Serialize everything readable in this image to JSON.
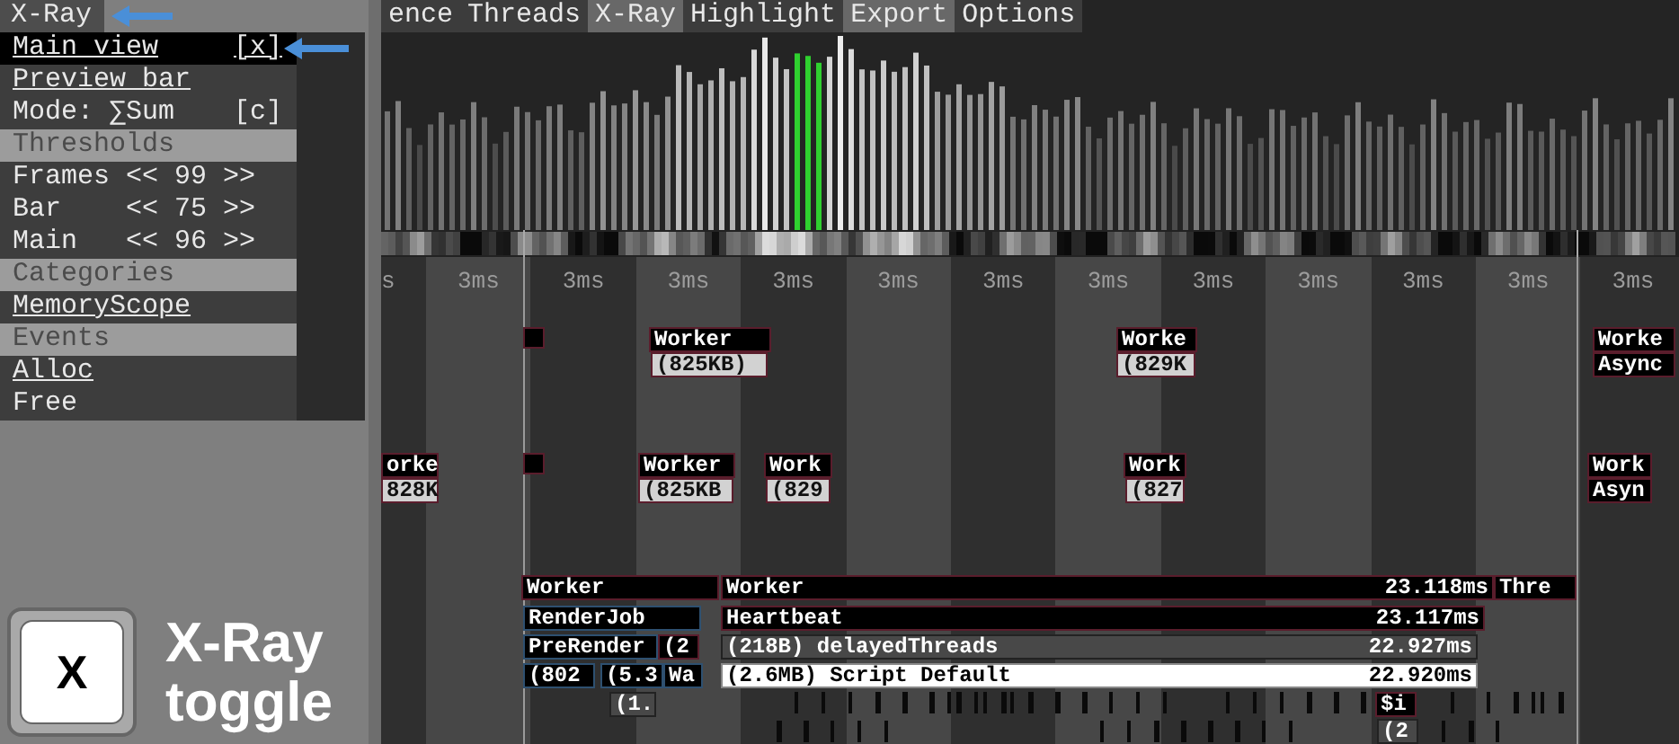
{
  "xray_menu": {
    "title": "X-Ray",
    "items": [
      {
        "kind": "toggle",
        "label": "Main view",
        "shortcut": "[x]",
        "on": true,
        "selected": true
      },
      {
        "kind": "toggle",
        "label": "Preview bar",
        "on": true,
        "selected": false
      },
      {
        "kind": "option",
        "label": "Mode: ∑Sum",
        "shortcut": "[c]",
        "selected": false
      },
      {
        "kind": "header",
        "label": "Thresholds"
      },
      {
        "kind": "stepper",
        "label": "Frames",
        "decrease": "<<",
        "value": "99",
        "increase": ">>",
        "selected": false
      },
      {
        "kind": "stepper",
        "label": "Bar",
        "decrease": "<<",
        "value": "75",
        "increase": ">>",
        "selected": false
      },
      {
        "kind": "stepper",
        "label": "Main",
        "decrease": "<<",
        "value": "96",
        "increase": ">>",
        "selected": false
      },
      {
        "kind": "header",
        "label": "Categories"
      },
      {
        "kind": "toggle",
        "label": "MemoryScope",
        "on": true,
        "selected": false
      },
      {
        "kind": "header",
        "label": "Events"
      },
      {
        "kind": "toggle",
        "label": "Alloc",
        "on": true,
        "selected": false
      },
      {
        "kind": "toggle",
        "label": "Free",
        "on": false,
        "selected": false
      }
    ]
  },
  "tabs": [
    {
      "label": "ence",
      "highlighted": false
    },
    {
      "label": "Threads",
      "highlighted": false
    },
    {
      "label": "X-Ray",
      "highlighted": true
    },
    {
      "label": "Highlight",
      "highlighted": false
    },
    {
      "label": "Export",
      "highlighted": true
    },
    {
      "label": "Options",
      "highlighted": false
    }
  ],
  "timeline": {
    "time_labels": [
      "s",
      "3ms",
      "3ms",
      "3ms",
      "3ms",
      "3ms",
      "3ms",
      "3ms",
      "3ms",
      "3ms",
      "3ms",
      "3ms",
      "3ms"
    ],
    "events": [
      {
        "kind": "marker"
      },
      {
        "kind": "thread",
        "label": "Worker"
      },
      {
        "kind": "thread",
        "label": "Worke"
      },
      {
        "kind": "thread",
        "label": "Worke"
      },
      {
        "kind": "size",
        "label": "(825KB)"
      },
      {
        "kind": "size",
        "label": "(829K"
      },
      {
        "kind": "thread",
        "label": "Async"
      },
      {
        "kind": "thread",
        "label": "orke"
      },
      {
        "kind": "marker"
      },
      {
        "kind": "thread",
        "label": "Worker"
      },
      {
        "kind": "thread",
        "label": "Work"
      },
      {
        "kind": "thread",
        "label": "Work"
      },
      {
        "kind": "thread",
        "label": "Work"
      },
      {
        "kind": "size",
        "label": "828K"
      },
      {
        "kind": "size",
        "label": "(825KB"
      },
      {
        "kind": "size",
        "label": "(829"
      },
      {
        "kind": "size",
        "label": "(827"
      },
      {
        "kind": "thread",
        "label": "Asyn"
      }
    ],
    "call_stack": [
      {
        "kind": "thread",
        "label": "Worker"
      },
      {
        "kind": "thread",
        "label": "Worker",
        "duration": "23.118ms"
      },
      {
        "kind": "thread",
        "label": "Thre"
      },
      {
        "kind": "scope",
        "label": "RenderJob"
      },
      {
        "kind": "thread",
        "label": "Heartbeat",
        "duration": "23.117ms"
      },
      {
        "kind": "scope",
        "label": "PreRender"
      },
      {
        "kind": "thread",
        "label": "(2"
      },
      {
        "kind": "memory",
        "label": "(218B) delayedThreads",
        "duration": "22.927ms"
      },
      {
        "kind": "scope",
        "label": "(802"
      },
      {
        "kind": "scope",
        "label": "(5.3"
      },
      {
        "kind": "scope",
        "label": "Wa"
      },
      {
        "kind": "highlight",
        "label": "(2.6MB) Script Default",
        "duration": "22.920ms"
      },
      {
        "kind": "memory",
        "label": "(1."
      },
      {
        "kind": "thread",
        "label": "$i"
      },
      {
        "kind": "memory",
        "label": "(2"
      }
    ]
  },
  "caption": {
    "key": "X",
    "text": "X-Ray toggle"
  }
}
